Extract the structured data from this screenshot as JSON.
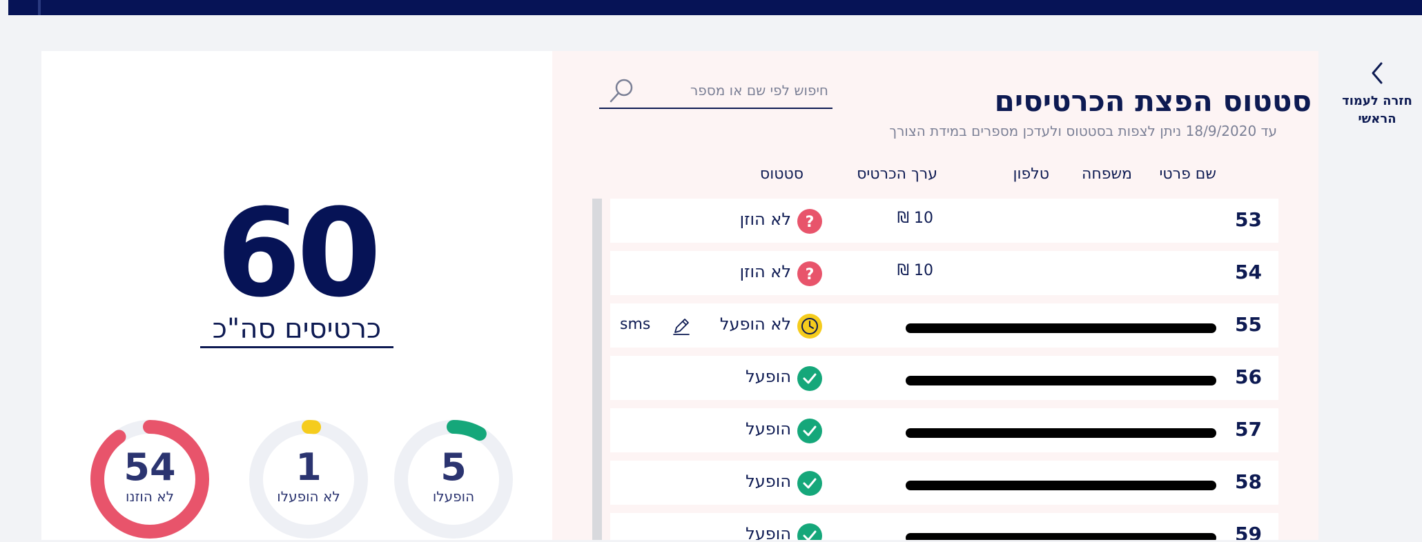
{
  "nav": {
    "back_label_line1": "חזרה לעמוד",
    "back_label_line2": "הראשי"
  },
  "header": {
    "title": "סטטוס הפצת הכרטיסים",
    "subtitle": "עד 18/9/2020 ניתן לצפות בסטטוס ולעדכן מספרים במידת הצורך"
  },
  "search": {
    "placeholder": "חיפוש לפי שם או מספר",
    "value": ""
  },
  "table": {
    "columns": [
      "שם פרטי",
      "משפחה",
      "טלפון",
      "ערך הכרטיס",
      "סטטוס"
    ],
    "rows": [
      {
        "num": "53",
        "masked": "",
        "value": "10 ₪",
        "status": "לא הוזן",
        "status_type": "not-entered",
        "sms": ""
      },
      {
        "num": "54",
        "masked": "",
        "value": "10 ₪",
        "status": "לא הוזן",
        "status_type": "not-entered",
        "sms": ""
      },
      {
        "num": "55",
        "masked": "",
        "value": "",
        "status": "לא הופעל",
        "status_type": "pending",
        "sms": "sms"
      },
      {
        "num": "56",
        "masked": "",
        "value": "",
        "status": "הופעל",
        "status_type": "active",
        "sms": ""
      },
      {
        "num": "57",
        "masked": "",
        "value": "",
        "status": "הופעל",
        "status_type": "active",
        "sms": ""
      },
      {
        "num": "58",
        "masked": "",
        "value": "",
        "status": "הופעל",
        "status_type": "active",
        "sms": ""
      },
      {
        "num": "59",
        "masked": "",
        "value": "",
        "status": "הופעל",
        "status_type": "active",
        "sms": ""
      }
    ]
  },
  "summary": {
    "total": "60",
    "total_label": "כרטיסים סה\"כ",
    "rings": [
      {
        "count": "54",
        "label": "לא הוזנו",
        "fraction": 0.9,
        "color": "#e8546b"
      },
      {
        "count": "1",
        "label": "לא הופעלו",
        "fraction": 0.017,
        "color": "#f5cc1d"
      },
      {
        "count": "5",
        "label": "הופעלו",
        "fraction": 0.083,
        "color": "#15a77a"
      }
    ]
  },
  "colors": {
    "navy": "#061356",
    "text": "#0d1a52",
    "muted": "#7a7f95",
    "red": "#e8546b",
    "yellow": "#f5cc1d",
    "green": "#15a77a",
    "panel_bg": "#fdf4f4"
  }
}
